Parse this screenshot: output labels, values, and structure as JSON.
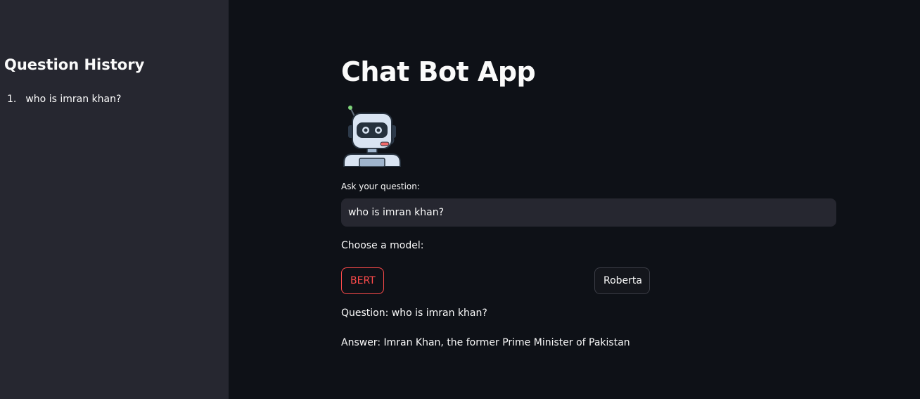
{
  "sidebar": {
    "title": "Question History",
    "history": [
      {
        "number": "1.",
        "text": "who is imran khan?"
      }
    ]
  },
  "main": {
    "title": "Chat Bot App",
    "robot_icon": "robot-icon",
    "ask_label": "Ask your question:",
    "question_value": "who is imran khan?",
    "model_label": "Choose a model:",
    "models": {
      "bert_label": "BERT",
      "roberta_label": "Roberta"
    },
    "question_text": "Question: who is imran khan?",
    "answer_text": "Answer: Imran Khan, the former Prime Minister of Pakistan"
  },
  "colors": {
    "background": "#0e1117",
    "sidebar": "#262730",
    "accent": "#ff4b4b",
    "text": "#fafafa"
  }
}
